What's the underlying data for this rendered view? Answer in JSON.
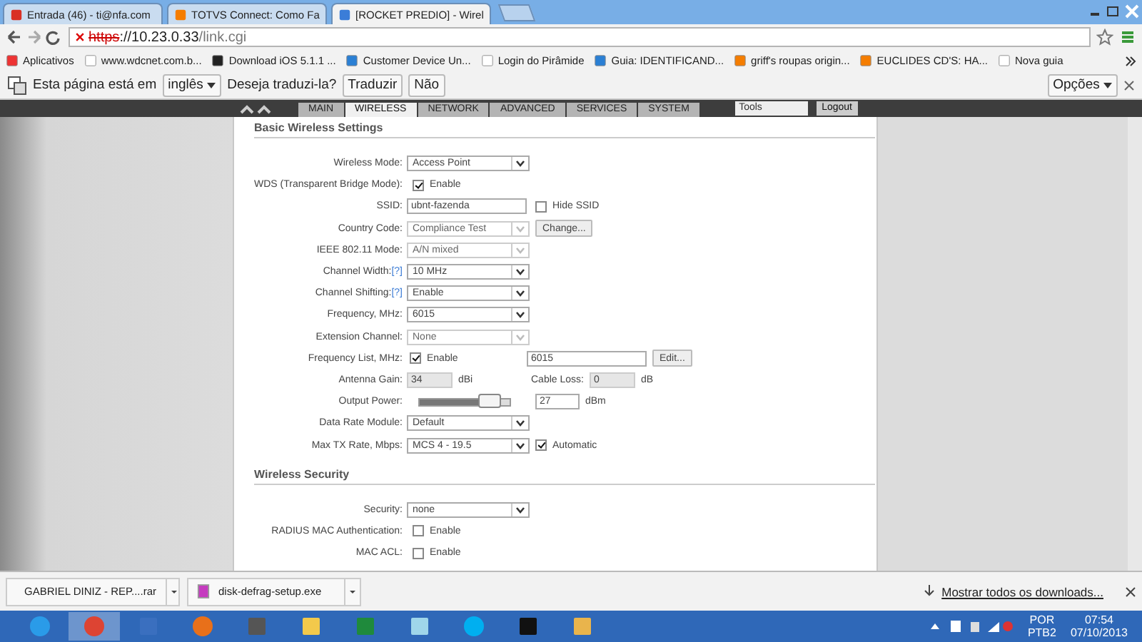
{
  "browser_tabs": [
    {
      "title": "Entrada (46) - ti@nfa.com",
      "kind": "mail",
      "selected": false
    },
    {
      "title": "TOTVS Connect: Como Fa",
      "kind": "blog",
      "selected": false
    },
    {
      "title": "[ROCKET PREDIO] - Wirel",
      "kind": "feed",
      "selected": true
    }
  ],
  "address_bar": {
    "scheme": "https",
    "rest": "://10.23.0.33",
    "path": "/link.cgi"
  },
  "bookmarks": [
    {
      "label": "Aplicativos",
      "kind": "apps"
    },
    {
      "label": "www.wdcnet.com.b...",
      "kind": "page"
    },
    {
      "label": "Download iOS 5.1.1 ...",
      "kind": "dark"
    },
    {
      "label": "Customer Device Un...",
      "kind": "globe"
    },
    {
      "label": "Login do Pirâmide",
      "kind": "page"
    },
    {
      "label": "Guia: IDENTIFICAND...",
      "kind": "globe"
    },
    {
      "label": "griff's roupas origin...",
      "kind": "blog"
    },
    {
      "label": "EUCLIDES CD'S: HA...",
      "kind": "blog"
    },
    {
      "label": "Nova guia",
      "kind": "page"
    }
  ],
  "translate_bar": {
    "prefix": "Esta página está em",
    "language": "inglês",
    "question": "Deseja traduzi-la?",
    "translate": "Traduzir",
    "decline": "Não",
    "options": "Opções"
  },
  "router": {
    "nav_tabs": [
      {
        "label": "MAIN",
        "selected": false
      },
      {
        "label": "WIRELESS",
        "selected": true
      },
      {
        "label": "NETWORK",
        "selected": false
      },
      {
        "label": "ADVANCED",
        "selected": false
      },
      {
        "label": "SERVICES",
        "selected": false
      },
      {
        "label": "SYSTEM",
        "selected": false
      }
    ],
    "tools": "Tools",
    "logout": "Logout",
    "sections": [
      {
        "title": "Basic Wireless Settings",
        "rows": [
          {
            "kind": "select",
            "label": "Wireless Mode:",
            "value": "Access Point",
            "disabled": false
          },
          {
            "kind": "checkbox",
            "label": "WDS (Transparent Bridge Mode):",
            "checked": true,
            "text": "Enable"
          },
          {
            "kind": "text",
            "label": "SSID:",
            "value": "ubnt-fazenda",
            "check": {
              "checked": false,
              "text": "Hide SSID"
            }
          },
          {
            "kind": "select",
            "label": "Country Code:",
            "value": "Compliance Test",
            "disabled": true,
            "button": "Change..."
          },
          {
            "kind": "select",
            "label": "IEEE 802.11 Mode:",
            "value": "A/N mixed",
            "disabled": true
          },
          {
            "kind": "select",
            "label": "Channel Width:",
            "help": "[?]",
            "value": "10 MHz",
            "disabled": false
          },
          {
            "kind": "select",
            "label": "Channel Shifting:",
            "help": "[?]",
            "value": "Enable",
            "disabled": false
          },
          {
            "kind": "select",
            "label": "Frequency, MHz:",
            "value": "6015",
            "disabled": false
          },
          {
            "kind": "select",
            "label": "Extension Channel:",
            "value": "None",
            "disabled": true
          },
          {
            "kind": "freqlist",
            "label": "Frequency List, MHz:",
            "checked": true,
            "text": "Enable",
            "value": "6015",
            "button": "Edit..."
          },
          {
            "kind": "gain",
            "label": "Antenna Gain:",
            "value": "34",
            "unit": "dBi",
            "label2": "Cable Loss:",
            "value2": "0",
            "unit2": "dB"
          },
          {
            "kind": "slider",
            "label": "Output Power:",
            "level": 0.9,
            "value": "27",
            "unit": "dBm"
          },
          {
            "kind": "select",
            "label": "Data Rate Module:",
            "value": "Default",
            "disabled": false
          },
          {
            "kind": "select",
            "label": "Max TX Rate, Mbps:",
            "value": "MCS 4 - 19.5",
            "disabled": false,
            "check": {
              "checked": true,
              "text": "Automatic"
            }
          }
        ]
      },
      {
        "title": "Wireless Security",
        "rows": [
          {
            "kind": "select",
            "label": "Security:",
            "value": "none",
            "disabled": false
          },
          {
            "kind": "checkbox",
            "label": "RADIUS MAC Authentication:",
            "checked": false,
            "text": "Enable"
          },
          {
            "kind": "checkbox",
            "label": "MAC ACL:",
            "checked": false,
            "text": "Enable"
          }
        ]
      }
    ]
  },
  "downloads": [
    {
      "name": "GABRIEL DINIZ - REP....rar",
      "kind": "file"
    },
    {
      "name": "disk-defrag-setup.exe",
      "kind": "exe"
    }
  ],
  "show_all_downloads": "Mostrar todos os downloads...",
  "taskbar": [
    {
      "kind": "ie",
      "selected": false
    },
    {
      "kind": "chrome",
      "selected": true
    },
    {
      "kind": "network",
      "selected": false
    },
    {
      "kind": "firefox",
      "selected": false
    },
    {
      "kind": "window",
      "selected": false
    },
    {
      "kind": "folder",
      "selected": false
    },
    {
      "kind": "excel",
      "selected": false
    },
    {
      "kind": "notepad",
      "selected": false
    },
    {
      "kind": "skype",
      "selected": false
    },
    {
      "kind": "cmd",
      "selected": false
    },
    {
      "kind": "paint",
      "selected": false
    }
  ],
  "tray": {
    "language": "POR",
    "layout": "PTB2",
    "time": "07:54",
    "date": "07/10/2013"
  }
}
